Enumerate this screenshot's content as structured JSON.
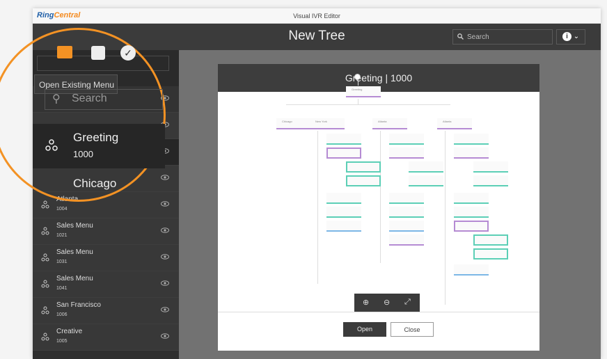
{
  "window": {
    "brand_ring": "Ring",
    "brand_central": "Central",
    "title": "Visual IVR Editor"
  },
  "header": {
    "title": "New Tree",
    "search_placeholder": "Search",
    "info_chevron": "⌄"
  },
  "toolbar": {
    "open_tooltip": "Open Existing Menu",
    "accent_color": "#f39224"
  },
  "sidebar": {
    "search_placeholder": "Search",
    "selected": {
      "name": "Greeting",
      "number": "1000"
    },
    "partial_item": "Chicago",
    "items": [
      {
        "name": "Atlanta",
        "number": "1004"
      },
      {
        "name": "Sales Menu",
        "number": "1021"
      },
      {
        "name": "Sales Menu",
        "number": "1031"
      },
      {
        "name": "Sales Menu",
        "number": "1041"
      },
      {
        "name": "San Francisco",
        "number": "1006"
      },
      {
        "name": "Creative",
        "number": "1005"
      }
    ]
  },
  "modal": {
    "title": "Greeting | 1000",
    "open_label": "Open",
    "close_label": "Close",
    "tree": {
      "root": "Greeting",
      "branches": [
        "Chicago",
        "New York",
        "Atlanta",
        "Atlanta"
      ]
    }
  }
}
